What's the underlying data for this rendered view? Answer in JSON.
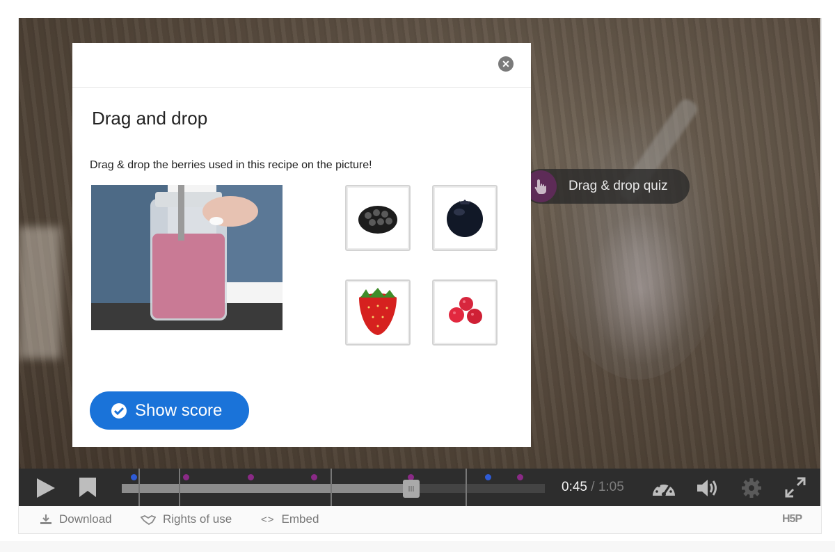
{
  "quiz_button": {
    "label": "Drag & drop quiz"
  },
  "dialog": {
    "title": "Drag and drop",
    "task": "Drag & drop the berries used in this recipe on the picture!",
    "draggables": [
      "blackberry",
      "blueberry",
      "strawberry",
      "raspberries"
    ],
    "show_score_label": "Show score"
  },
  "player": {
    "current_time": "0:45",
    "separator": "/",
    "duration": "1:05",
    "progress": 0.692
  },
  "footer": {
    "download": "Download",
    "rights": "Rights of use",
    "embed_icon": "<>",
    "embed": "Embed",
    "logo": "H5P"
  },
  "colors": {
    "accent": "#1a73d9",
    "interaction_purple": "#5d2b57",
    "marker_blue": "#2e5bd6",
    "marker_purple": "#8a2a86"
  }
}
